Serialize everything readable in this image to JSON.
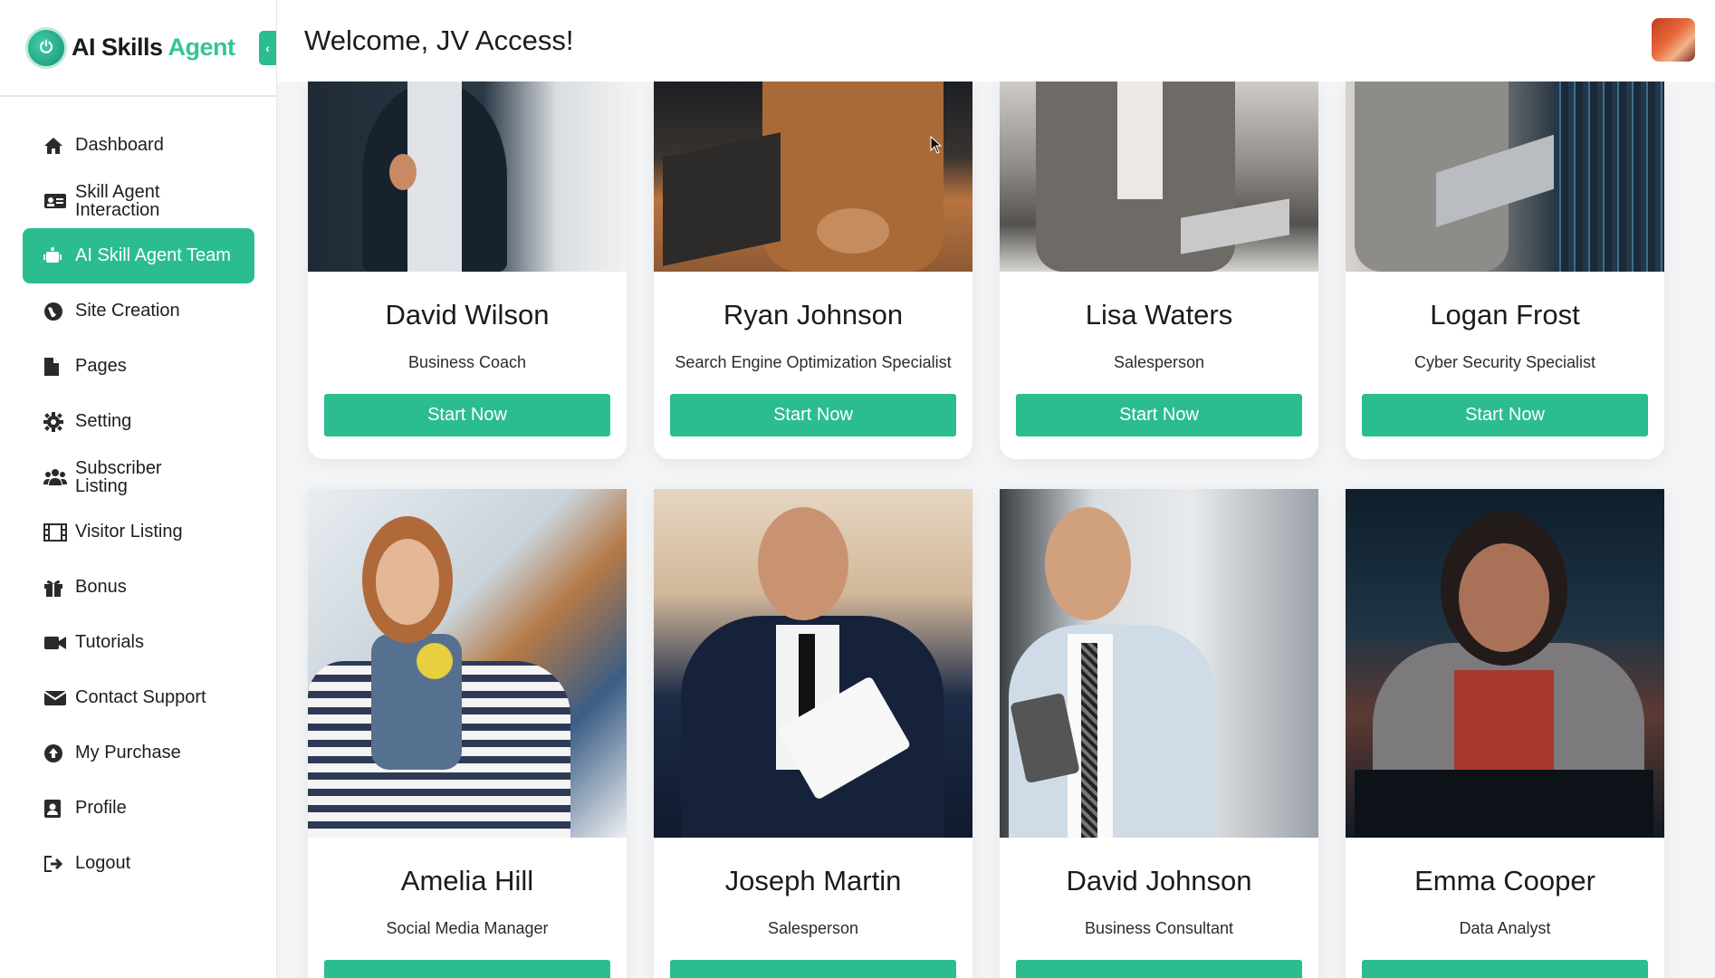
{
  "brand": {
    "name_part1": "AI Skills",
    "name_part2": "Agent",
    "collapse_icon": "chevron-left-icon"
  },
  "header": {
    "welcome": "Welcome, JV Access!"
  },
  "sidebar": {
    "items": [
      {
        "label": "Dashboard",
        "icon": "home-icon"
      },
      {
        "label": "Skill Agent Interaction",
        "icon": "id-card-icon"
      },
      {
        "label": "AI Skill Agent Team",
        "icon": "robot-icon",
        "active": true
      },
      {
        "label": "Site Creation",
        "icon": "globe-icon"
      },
      {
        "label": "Pages",
        "icon": "file-icon"
      },
      {
        "label": "Setting",
        "icon": "gear-icon"
      },
      {
        "label": "Subscriber Listing",
        "icon": "users-icon"
      },
      {
        "label": "Visitor Listing",
        "icon": "film-icon"
      },
      {
        "label": "Bonus",
        "icon": "gift-icon"
      },
      {
        "label": "Tutorials",
        "icon": "video-icon"
      },
      {
        "label": "Contact Support",
        "icon": "envelope-icon"
      },
      {
        "label": "My Purchase",
        "icon": "upload-circle-icon"
      },
      {
        "label": "Profile",
        "icon": "user-badge-icon"
      },
      {
        "label": "Logout",
        "icon": "logout-icon"
      }
    ]
  },
  "agents": [
    {
      "name": "David Wilson",
      "role": "Business Coach",
      "button": "Start Now"
    },
    {
      "name": "Ryan Johnson",
      "role": "Search Engine Optimization Specialist",
      "button": "Start Now"
    },
    {
      "name": "Lisa Waters",
      "role": "Salesperson",
      "button": "Start Now"
    },
    {
      "name": "Logan Frost",
      "role": "Cyber Security Specialist",
      "button": "Start Now"
    },
    {
      "name": "Amelia Hill",
      "role": "Social Media Manager",
      "button": ""
    },
    {
      "name": "Joseph Martin",
      "role": "Salesperson",
      "button": ""
    },
    {
      "name": "David Johnson",
      "role": "Business Consultant",
      "button": ""
    },
    {
      "name": "Emma Cooper",
      "role": "Data Analyst",
      "button": ""
    }
  ],
  "colors": {
    "accent": "#2bbd8f",
    "background": "#f3f4f6"
  }
}
